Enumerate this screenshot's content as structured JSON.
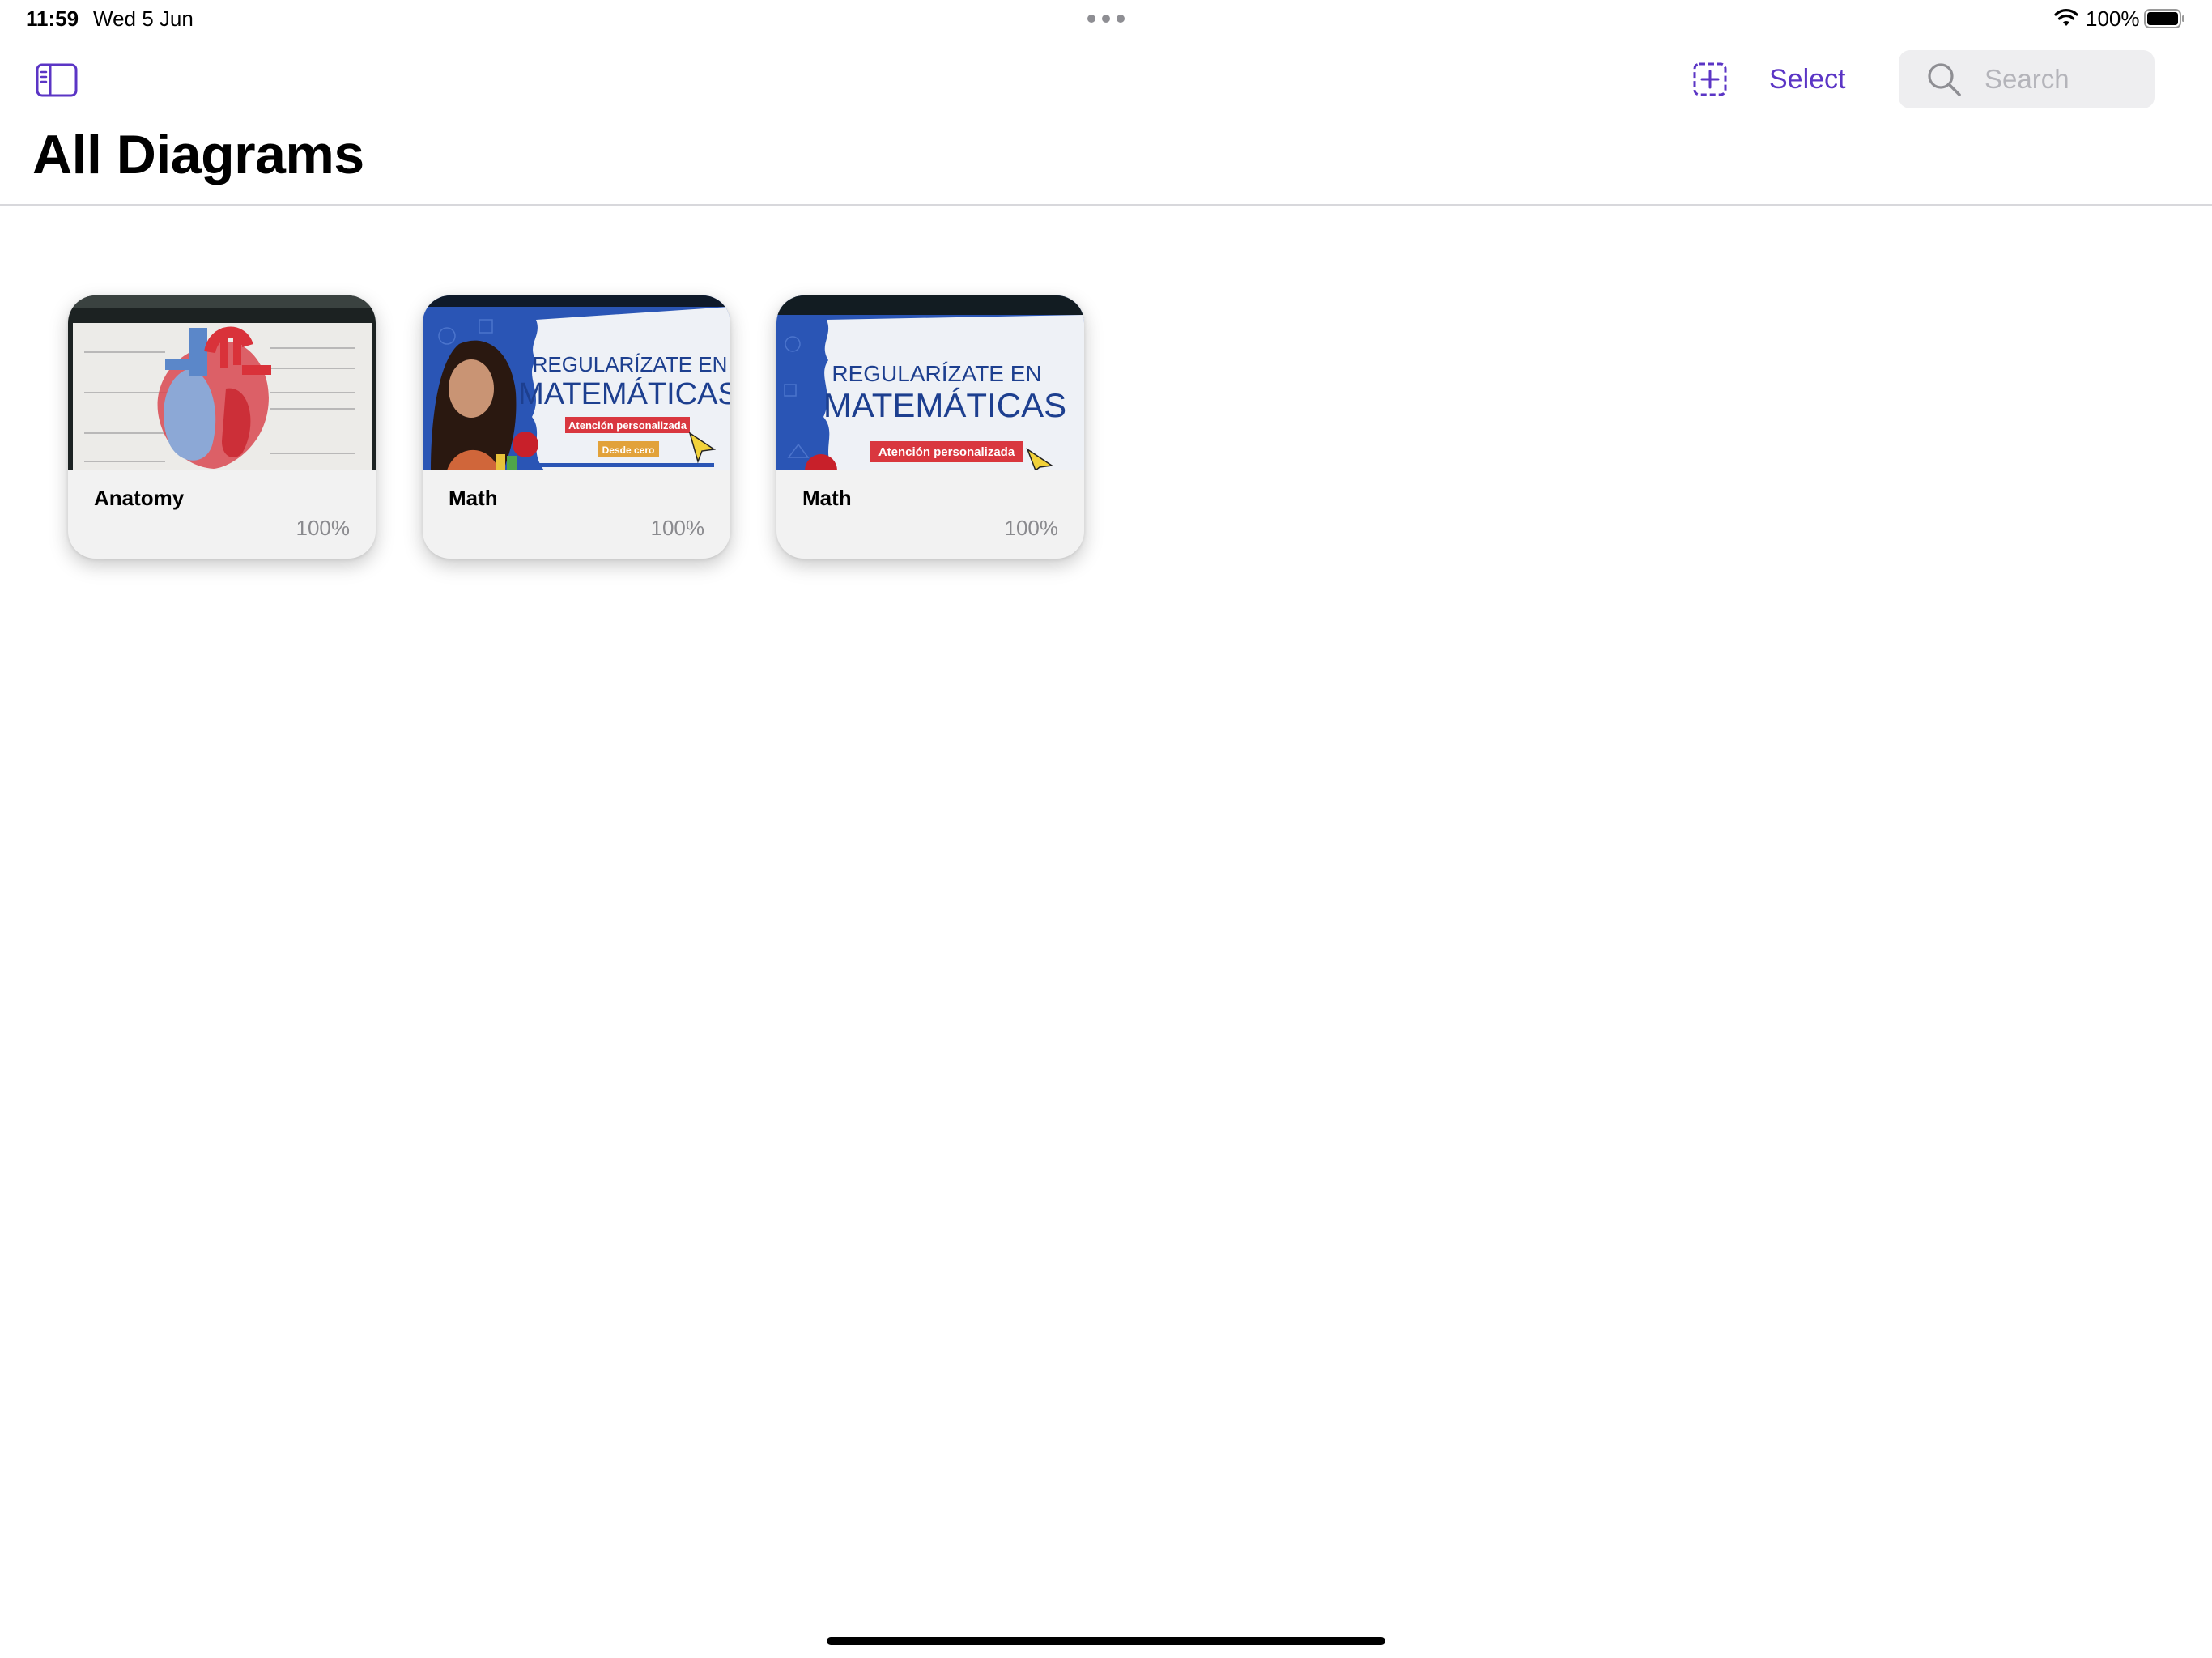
{
  "status_bar": {
    "time": "11:59",
    "date": "Wed 5 Jun",
    "battery": "100%"
  },
  "toolbar": {
    "select_label": "Select",
    "search_placeholder": "Search"
  },
  "header": {
    "title": "All Diagrams"
  },
  "diagrams": [
    {
      "name": "Anatomy",
      "progress": "100%",
      "thumbnail": "heart-diagram-photo"
    },
    {
      "name": "Math",
      "progress": "100%",
      "thumbnail": "math-poster-photo",
      "poster": {
        "line1": "REGULARÍZATE EN",
        "line2": "MATEMÁTICAS",
        "tag1": "Atención personalizada",
        "tag2": "Desde cero"
      }
    },
    {
      "name": "Math",
      "progress": "100%",
      "thumbnail": "math-poster-photo",
      "poster": {
        "line1": "REGULARÍZATE EN",
        "line2": "MATEMÁTICAS",
        "tag1": "Atención personalizada"
      }
    }
  ],
  "colors": {
    "accent": "#5b35c5",
    "search_bg": "#eeeef0",
    "card_bg": "#f2f2f2",
    "secondary_text": "#8a8a8e"
  }
}
